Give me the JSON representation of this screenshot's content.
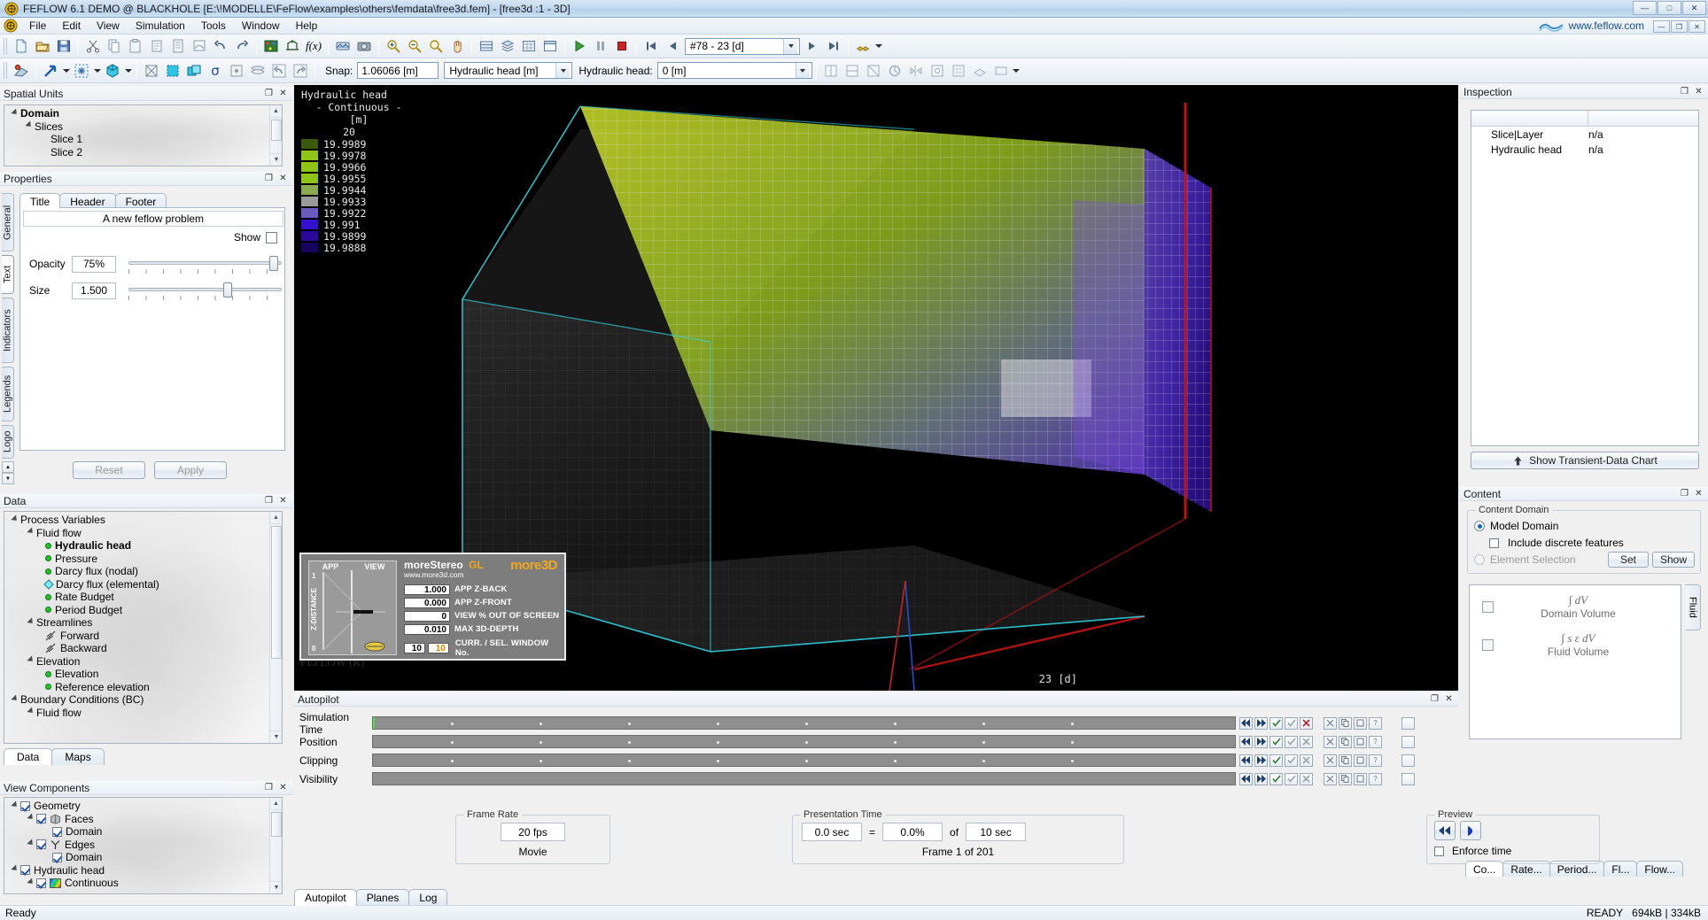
{
  "window": {
    "title": "FEFLOW 6.1 DEMO @ BLACKHOLE [E:\\!MODELLE\\FeFlow\\examples\\others\\femdata\\free3d.fem] - [free3d :1 - 3D]",
    "app_icon": "feflow-logo-icon",
    "buttons": [
      {
        "name": "minimize",
        "glyph": "—"
      },
      {
        "name": "maximize",
        "glyph": "□"
      },
      {
        "name": "close",
        "glyph": "✕"
      }
    ],
    "mdi_buttons": [
      {
        "name": "mdi-minimize",
        "glyph": "—"
      },
      {
        "name": "mdi-restore",
        "glyph": "❐"
      },
      {
        "name": "mdi-close",
        "glyph": "✕"
      }
    ]
  },
  "menu": {
    "items": [
      "File",
      "Edit",
      "View",
      "Simulation",
      "Tools",
      "Window",
      "Help"
    ],
    "brand_text": "www.feflow.com"
  },
  "toolbar_row1": {
    "groups": [
      [
        "new-document-icon",
        "open-folder-icon",
        "save-disk-icon"
      ],
      [
        "cut-scissors-icon",
        "copy-icon",
        "paste-icon",
        "duplicate-icon",
        "export-icon",
        "import-icon",
        "undo-arrow-icon",
        "redo-arrow-icon"
      ],
      [
        "mesh-nodes-icon",
        "supermesh-icon",
        "function-fx-icon"
      ],
      [
        "panorama-icon",
        "camera-snapshot-icon"
      ],
      [
        "zoom-in-icon",
        "zoom-out-icon",
        "zoom-fit-icon",
        "pan-hand-icon"
      ],
      [
        "slice-view-icon",
        "layer-view-icon",
        "grid-view-icon",
        "window-view-icon"
      ],
      [
        "run-play-icon",
        "pause-icon",
        "stop-icon"
      ],
      [
        "first-frame-icon",
        "prev-frame-icon"
      ]
    ],
    "time_combo": {
      "value": "#78 -  23 [d]",
      "label": ""
    },
    "nav_after": [
      "next-frame-icon",
      "last-frame-icon"
    ],
    "tail": [
      "timeline-icon"
    ]
  },
  "toolbar_row2": {
    "left_icons": [
      "face-select-icon"
    ],
    "tool_groups": [
      [
        "arrow-select-icon",
        "point-select-icon",
        "cube-select-icon"
      ],
      [
        "box-cross-icon",
        "box-fill-icon",
        "box-copy-icon",
        "sigma-icon",
        "node-box-icon",
        "layer-stack-icon",
        "undo-sel-icon",
        "redo-sel-icon"
      ]
    ],
    "snap_label": "Snap:",
    "snap_value": "1.06066 [m]",
    "param_combo": "Hydraulic head [m]",
    "field_label": "Hydraulic head:",
    "field_value": "0 [m]",
    "right_icons": [
      "cut-x-icon",
      "cut-y-icon",
      "cut-z-icon",
      "reset-view-icon",
      "mirror-icon",
      "settings-icon",
      "grid-icon",
      "slice-icon",
      "plane-icon"
    ]
  },
  "spatial_units": {
    "header": "Spatial Units",
    "items": [
      {
        "label": "Domain",
        "depth": 0,
        "bold": true,
        "twisty": true
      },
      {
        "label": "Slices",
        "depth": 1,
        "bold": false,
        "twisty": true
      },
      {
        "label": "Slice 1",
        "depth": 2,
        "bold": false,
        "twisty": false
      },
      {
        "label": "Slice 2",
        "depth": 2,
        "bold": false,
        "twisty": false
      }
    ]
  },
  "properties": {
    "header": "Properties",
    "vtabs": [
      "General",
      "Text",
      "Indicators",
      "Legends",
      "Logo"
    ],
    "vtab_selected": "Text",
    "htabs": [
      "Title",
      "Header",
      "Footer"
    ],
    "htab_selected": "Title",
    "title_value": "A new feflow problem",
    "show_label": "Show",
    "opacity_label": "Opacity",
    "opacity_value": "75%",
    "opacity_pct": 92,
    "size_label": "Size",
    "size_value": "1.500",
    "size_pct": 62,
    "reset_label": "Reset",
    "apply_label": "Apply"
  },
  "data_panel": {
    "header": "Data",
    "tabs": [
      "Data",
      "Maps"
    ],
    "tab_selected": "Data",
    "items": [
      {
        "label": "Process Variables",
        "depth": 0,
        "icon": "twisty",
        "bold": false
      },
      {
        "label": "Fluid flow",
        "depth": 1,
        "icon": "twisty",
        "bold": false
      },
      {
        "label": "Hydraulic head",
        "depth": 2,
        "icon": "green-dot",
        "bold": true
      },
      {
        "label": "Pressure",
        "depth": 2,
        "icon": "green-dot",
        "bold": false
      },
      {
        "label": "Darcy flux (nodal)",
        "depth": 2,
        "icon": "green-dot",
        "bold": false
      },
      {
        "label": "Darcy flux (elemental)",
        "depth": 2,
        "icon": "cyan-diamond",
        "bold": false
      },
      {
        "label": "Rate Budget",
        "depth": 2,
        "icon": "green-dot",
        "bold": false
      },
      {
        "label": "Period Budget",
        "depth": 2,
        "icon": "green-dot",
        "bold": false
      },
      {
        "label": "Streamlines",
        "depth": 1,
        "icon": "twisty",
        "bold": false
      },
      {
        "label": "Forward",
        "depth": 2,
        "icon": "streamline",
        "bold": false
      },
      {
        "label": "Backward",
        "depth": 2,
        "icon": "streamline",
        "bold": false
      },
      {
        "label": "Elevation",
        "depth": 1,
        "icon": "twisty",
        "bold": false
      },
      {
        "label": "Elevation",
        "depth": 2,
        "icon": "green-dot",
        "bold": false
      },
      {
        "label": "Reference elevation",
        "depth": 2,
        "icon": "green-dot",
        "bold": false
      },
      {
        "label": "Boundary Conditions (BC)",
        "depth": 0,
        "icon": "twisty",
        "bold": false
      },
      {
        "label": "Fluid flow",
        "depth": 1,
        "icon": "twisty",
        "bold": false
      }
    ]
  },
  "view_components": {
    "header": "View Components",
    "items": [
      {
        "label": "Geometry",
        "depth": 0,
        "twisty": true,
        "checked": true,
        "icon": ""
      },
      {
        "label": "Faces",
        "depth": 1,
        "twisty": true,
        "checked": true,
        "icon": "cube-icon"
      },
      {
        "label": "Domain",
        "depth": 2,
        "twisty": false,
        "checked": true,
        "icon": ""
      },
      {
        "label": "Edges",
        "depth": 1,
        "twisty": true,
        "checked": true,
        "icon": "edges-icon"
      },
      {
        "label": "Domain",
        "depth": 2,
        "twisty": false,
        "checked": true,
        "icon": ""
      },
      {
        "label": "Hydraulic head",
        "depth": 0,
        "twisty": true,
        "checked": true,
        "icon": ""
      },
      {
        "label": "Continuous",
        "depth": 1,
        "twisty": true,
        "checked": true,
        "icon": "rainbow-icon"
      }
    ]
  },
  "view3d": {
    "timestamp": "23 [d]",
    "watermark": "FEFLOW (R)",
    "legend": {
      "title": "Hydraulic head",
      "subtitle": "- Continuous -",
      "unit": "[m]",
      "top_value": "20",
      "entries": [
        {
          "value": "19.9989",
          "color": "#3c5a0e"
        },
        {
          "value": "19.9978",
          "color": "#8fc314"
        },
        {
          "value": "19.9966",
          "color": "#8fc314"
        },
        {
          "value": "19.9955",
          "color": "#8fc314"
        },
        {
          "value": "19.9944",
          "color": "#8ba94f"
        },
        {
          "value": "19.9933",
          "color": "#9a9a9a"
        },
        {
          "value": "19.9922",
          "color": "#6a5bc0"
        },
        {
          "value": "19.991",
          "color": "#3610cf"
        },
        {
          "value": "19.9899",
          "color": "#2a089c"
        },
        {
          "value": "19.9888",
          "color": "#16035e"
        }
      ]
    },
    "stereo": {
      "brand": "moreStereo",
      "brand_gl": "GL",
      "url": "www.more3d.com",
      "logo": "more3D",
      "col_app": "APP",
      "col_view": "VIEW",
      "axis_label": "Z-DISTANCE",
      "axis_max": "1",
      "axis_min": "0",
      "rows": [
        {
          "value": "1.000",
          "label": "APP Z-BACK"
        },
        {
          "value": "0.000",
          "label": "APP Z-FRONT"
        },
        {
          "value": "0",
          "label": "VIEW % OUT OF SCREEN"
        },
        {
          "value": "0.010",
          "label": "MAX 3D-DEPTH"
        }
      ],
      "window_row": {
        "value_a": "10",
        "value_b": "10",
        "label": "CURR. / SEL. WINDOW No."
      }
    }
  },
  "inspection": {
    "header": "Inspection",
    "col_headers": [
      "",
      ""
    ],
    "rows": [
      {
        "name": "Slice|Layer",
        "value": "n/a"
      },
      {
        "name": "Hydraulic head",
        "value": "n/a"
      }
    ],
    "chart_button": "Show Transient-Data Chart"
  },
  "content": {
    "header": "Content",
    "group_title": "Content Domain",
    "model_domain_label": "Model Domain",
    "model_domain_selected": true,
    "include_discrete_label": "Include discrete features",
    "include_discrete_checked": false,
    "element_selection_label": "Element Selection",
    "element_selection_selected": false,
    "set_label": "Set",
    "show_label": "Show",
    "side_tab": "Fluid",
    "entries": [
      {
        "formula": "∫ dV",
        "name": "Domain Volume",
        "checked": false
      },
      {
        "formula": "∫ s ε dV",
        "name": "Fluid Volume",
        "checked": false
      }
    ],
    "bottom_tabs": [
      "Co...",
      "Rate...",
      "Period...",
      "Fl...",
      "Flow..."
    ],
    "bottom_tab_selected": "Co..."
  },
  "autopilot": {
    "header": "Autopilot",
    "tracks": [
      {
        "label": "Simulation Time"
      },
      {
        "label": "Position"
      },
      {
        "label": "Clipping"
      },
      {
        "label": "Visibility"
      }
    ],
    "frame_rate": {
      "title": "Frame Rate",
      "value": "20 fps",
      "caption": "Movie"
    },
    "presentation_time": {
      "title": "Presentation Time",
      "current": "0.0 sec",
      "equals": "=",
      "percent": "0.0%",
      "of": "of",
      "total": "10 sec",
      "caption": "Frame 1 of 201"
    },
    "preview": {
      "title": "Preview",
      "rewind_icon": "rewind-icon",
      "play_icon": "play-icon",
      "enforce_label": "Enforce time",
      "enforce_checked": false
    },
    "tabs": [
      "Autopilot",
      "Planes",
      "Log"
    ],
    "tab_selected": "Autopilot"
  },
  "statusbar": {
    "left": "Ready",
    "ready": "READY",
    "memory": "694kB | 334kB"
  },
  "colors": {
    "accent": "#1565c0",
    "green_dot": "#22c12a",
    "panel_bg": "#f0f0f0",
    "view_bg": "#000000"
  }
}
